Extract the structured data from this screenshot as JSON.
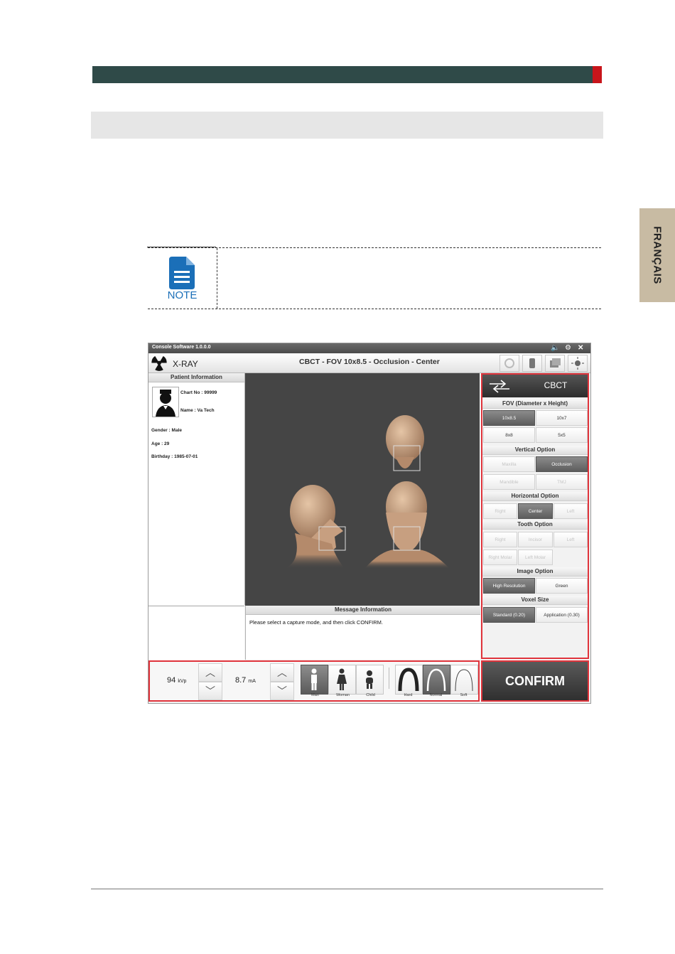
{
  "sidebar_tab": {
    "label": "FRANÇAIS"
  },
  "note": {
    "label": "NOTE"
  },
  "window": {
    "title": "Console Software  1.0.0.0",
    "app_label": "X-RAY",
    "header_title": "CBCT - FOV 10x8.5 - Occlusion - Center"
  },
  "patient": {
    "heading": "Patient Information",
    "chart_no": "Chart No : 99999",
    "name": "Name : Va Tech",
    "gender": "Gender : Male",
    "age": "Age : 29",
    "birthday": "Birthday : 1985-07-01"
  },
  "message": {
    "heading": "Message Information",
    "text": "Please select a capture mode, and then click CONFIRM."
  },
  "right_panel": {
    "mode": "CBCT",
    "fov_heading": "FOV (Diameter x Height)",
    "fov_options": [
      "10x8.5",
      "10x7",
      "8x8",
      "5x5"
    ],
    "vertical_heading": "Vertical Option",
    "vertical_options": [
      "Maxilla",
      "Occlusion",
      "Mandible",
      "TMJ"
    ],
    "horizontal_heading": "Horizontal Option",
    "horizontal_options": [
      "Right",
      "Center",
      "Left"
    ],
    "tooth_heading": "Tooth Option",
    "tooth_options": [
      "Right",
      "Incisor",
      "Left",
      "Right Molar",
      "Left Molar"
    ],
    "image_heading": "Image Option",
    "image_options": [
      "High Resolution",
      "Green"
    ],
    "voxel_heading": "Voxel Size",
    "voxel_options": [
      "Standard  (0.20)",
      "Application (0.30)"
    ]
  },
  "exposure": {
    "kvp_value": "94",
    "kvp_unit": "kVp",
    "ma_value": "8.7",
    "ma_unit": "mA",
    "patient_types": [
      "Man",
      "Woman",
      "Child"
    ],
    "arch_types": [
      "Hard",
      "Normal",
      "Soft"
    ]
  },
  "confirm_label": "CONFIRM",
  "colors": {
    "accent_red": "#e0343c",
    "header_dark": "#2f4a48",
    "selected": "#6b6b6b"
  }
}
